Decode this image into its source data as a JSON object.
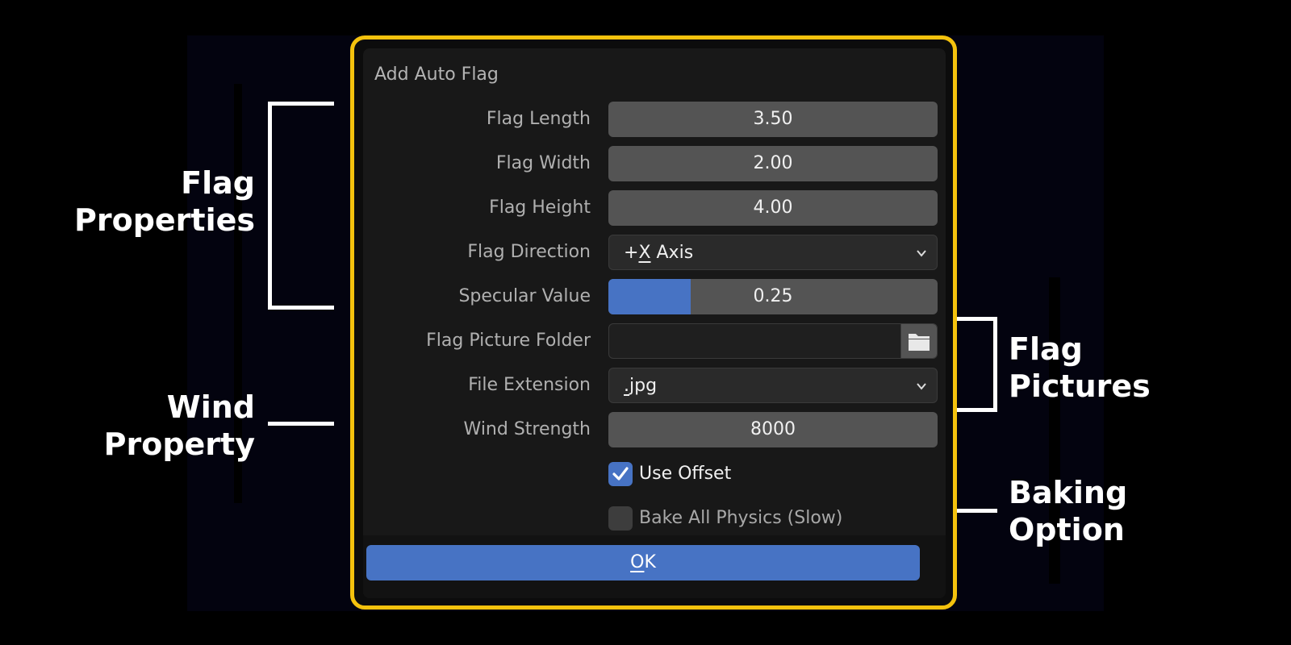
{
  "dialog": {
    "title": "Add Auto Flag",
    "fields": {
      "flag_length": {
        "label": "Flag Length",
        "value": "3.50"
      },
      "flag_width": {
        "label": "Flag Width",
        "value": "2.00"
      },
      "flag_height": {
        "label": "Flag Height",
        "value": "4.00"
      },
      "flag_direction": {
        "label": "Flag Direction",
        "value_prefix": "+",
        "value_key": "X",
        "value_suffix": " Axis"
      },
      "specular_value": {
        "label": "Specular Value",
        "value": "0.25",
        "fill_fraction": 0.25
      },
      "flag_picture_folder": {
        "label": "Flag Picture Folder",
        "value": ""
      },
      "file_extension": {
        "label": "File Extension",
        "value_key": ".",
        "value_suffix": "jpg"
      },
      "wind_strength": {
        "label": "Wind Strength",
        "value": "8000"
      }
    },
    "checkboxes": {
      "use_offset": {
        "label": "Use Offset",
        "checked": true
      },
      "bake_all_physics": {
        "label": "Bake All Physics (Slow)",
        "checked": false
      }
    },
    "ok": {
      "key": "O",
      "rest": "K"
    }
  },
  "annotations": {
    "flag_properties": [
      "Flag",
      "Properties"
    ],
    "wind_property": [
      "Wind",
      "Property"
    ],
    "flag_pictures": [
      "Flag",
      "Pictures"
    ],
    "baking_option": [
      "Baking",
      "Option"
    ]
  },
  "colors": {
    "accent": "#4773c4",
    "frame": "#f4c20d",
    "field": "#545454"
  },
  "icons": {
    "folder": "folder-icon",
    "dropdown": "chevron-down-icon",
    "check": "checkmark-icon"
  }
}
